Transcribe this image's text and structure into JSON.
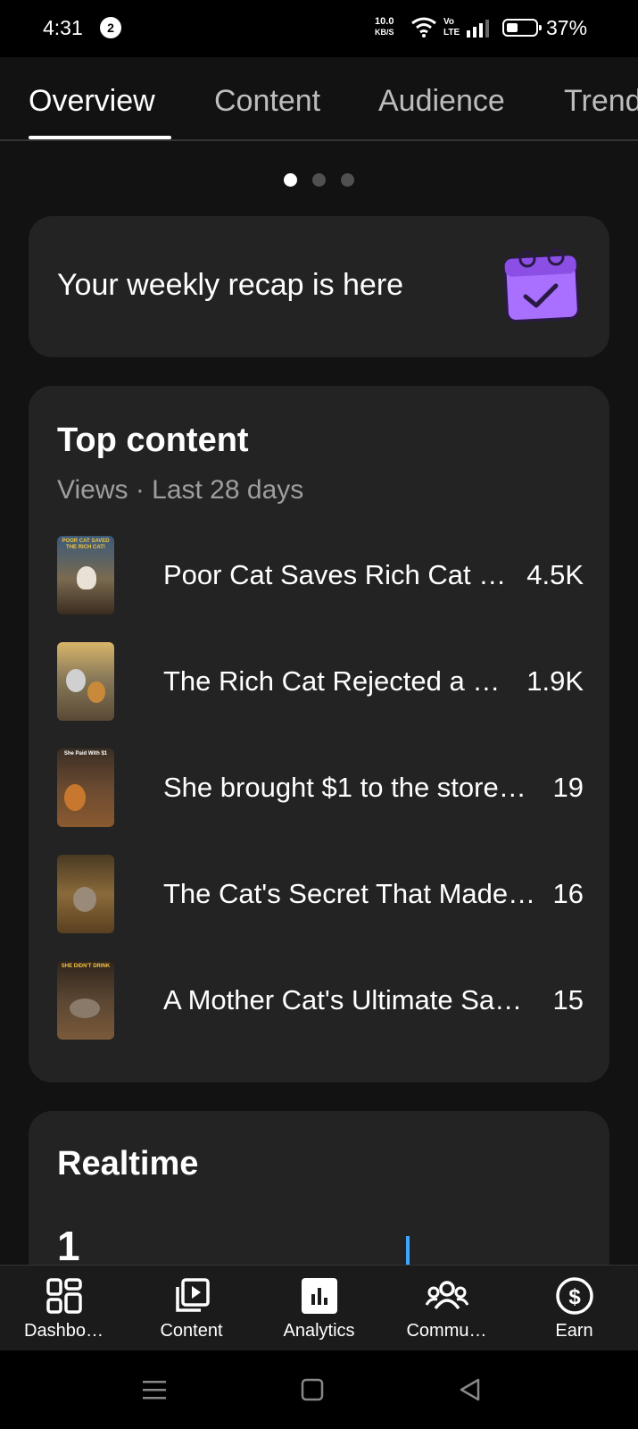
{
  "status_bar": {
    "time": "4:31",
    "notification_count": "2",
    "net_speed_value": "10.0",
    "net_speed_unit": "KB/S",
    "network_type_top": "Vo",
    "network_type_bottom": "LTE",
    "battery_percent": "37%",
    "battery_level": 0.37
  },
  "tabs": [
    {
      "label": "Overview",
      "active": true
    },
    {
      "label": "Content",
      "active": false
    },
    {
      "label": "Audience",
      "active": false
    },
    {
      "label": "Trend",
      "active": false
    }
  ],
  "carousel": {
    "pages": 3,
    "active_index": 0
  },
  "recap": {
    "text": "Your weekly recap is here",
    "icon": "calendar-check-icon",
    "icon_color": "#a970ff"
  },
  "top_content": {
    "title": "Top content",
    "subtitle": "Views · Last 28 days",
    "items": [
      {
        "title": "Poor Cat Saves Rich Cat …",
        "views": "4.5K",
        "thumb_caption": "POOR CAT SAVED THE RICH CAT!"
      },
      {
        "title": "The Rich Cat Rejected a …",
        "views": "1.9K",
        "thumb_caption": ""
      },
      {
        "title": "She brought $1 to the store…",
        "views": "19",
        "thumb_caption": "She Paid With $1"
      },
      {
        "title": "The Cat's Secret That Made…",
        "views": "16",
        "thumb_caption": ""
      },
      {
        "title": "A Mother Cat's Ultimate Sa…",
        "views": "15",
        "thumb_caption": "SHE DIDN'T DRINK"
      }
    ]
  },
  "realtime": {
    "title": "Realtime",
    "value": "1",
    "accent": "#3ea6ff"
  },
  "bottom_nav": [
    {
      "label": "Dashbo…",
      "icon": "dashboard-icon"
    },
    {
      "label": "Content",
      "icon": "content-library-icon"
    },
    {
      "label": "Analytics",
      "icon": "analytics-icon",
      "active": true
    },
    {
      "label": "Commu…",
      "icon": "community-icon"
    },
    {
      "label": "Earn",
      "icon": "earn-dollar-icon"
    }
  ],
  "colors": {
    "background": "#121212",
    "card": "#232323",
    "text_secondary": "#9e9e9e"
  }
}
